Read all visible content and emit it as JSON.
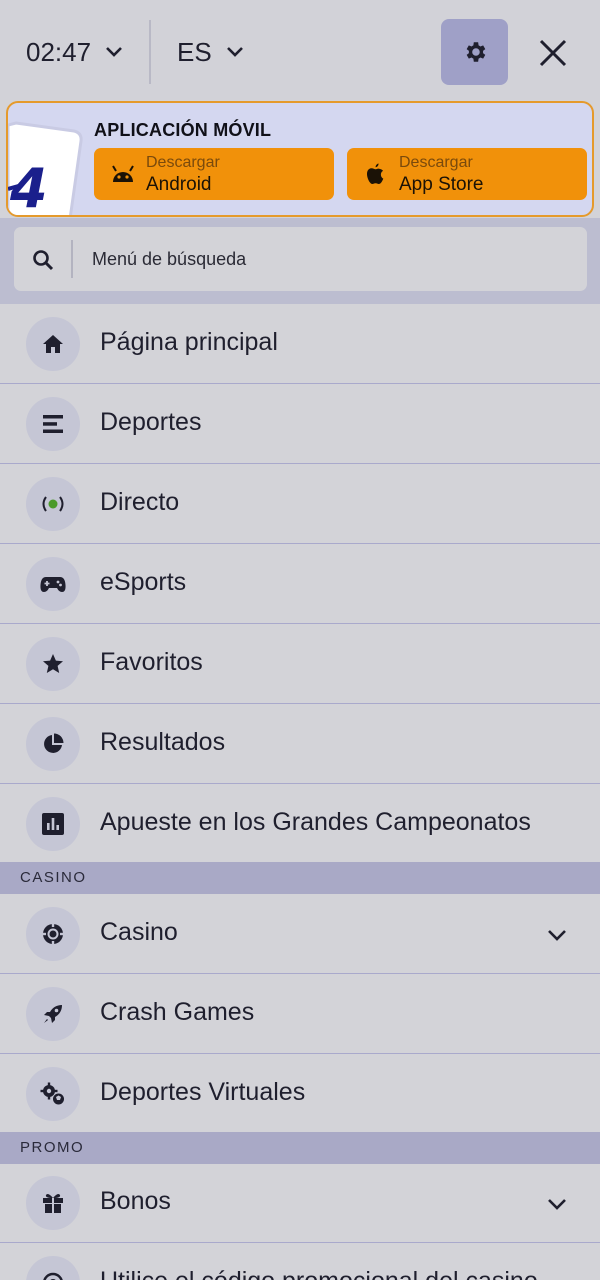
{
  "header": {
    "time": "02:47",
    "language": "ES"
  },
  "app_banner": {
    "title": "APLICACIÓN MÓVIL",
    "android": {
      "small": "Descargar",
      "big": "Android"
    },
    "ios": {
      "small": "Descargar",
      "big": "App Store"
    }
  },
  "search": {
    "placeholder": "Menú de búsqueda"
  },
  "menu": {
    "main": [
      {
        "label": "Página principal",
        "icon": "home-icon"
      },
      {
        "label": "Deportes",
        "icon": "list-icon"
      },
      {
        "label": "Directo",
        "icon": "live-icon"
      },
      {
        "label": "eSports",
        "icon": "gamepad-icon"
      },
      {
        "label": "Favoritos",
        "icon": "star-icon"
      },
      {
        "label": "Resultados",
        "icon": "pie-chart-icon"
      },
      {
        "label": "Apueste en los Grandes Campeonatos",
        "icon": "bar-chart-icon"
      }
    ],
    "casino_header": "CASINO",
    "casino": [
      {
        "label": "Casino",
        "icon": "chip-icon"
      },
      {
        "label": "Crash Games",
        "icon": "rocket-icon"
      },
      {
        "label": "Deportes Virtuales",
        "icon": "virtual-sports-icon"
      }
    ],
    "promo_header": "PROMO",
    "promo": [
      {
        "label": "Bonos",
        "icon": "gift-icon"
      },
      {
        "label": "Utilice el código promocional del casino",
        "icon": "promo-code-icon"
      }
    ]
  },
  "colors": {
    "accent_orange": "#f1910a",
    "banner_border": "#e59a2c",
    "settings_bg": "#9fa0c7",
    "brand_navy": "#1a1f8c"
  }
}
